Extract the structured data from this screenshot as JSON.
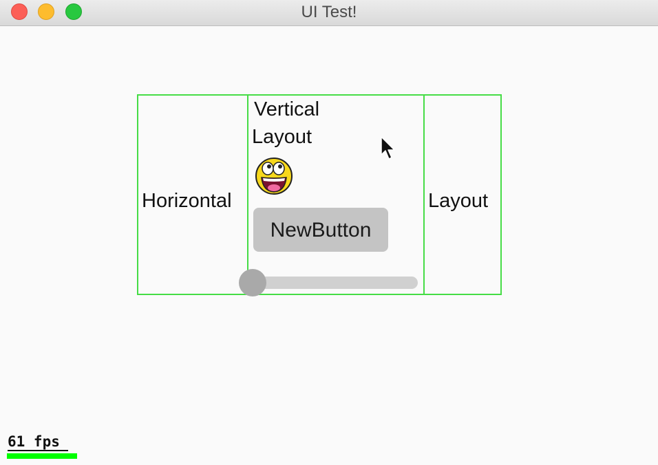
{
  "window": {
    "title": "UI Test!"
  },
  "layout": {
    "left_label": "Horizontal",
    "right_label": "Layout",
    "vertical_line1": "Vertical",
    "vertical_line2": "Layout",
    "border_color": "#45dc45"
  },
  "image": {
    "icon": "awesome-smiley-face-icon"
  },
  "button": {
    "label": "NewButton"
  },
  "slider": {
    "value": 0.0
  },
  "stats": {
    "fps_text": "61 fps",
    "fps_bar_fraction": 1.0,
    "fps_bar_color": "#00ff00"
  },
  "colors": {
    "close": "#fc5f57",
    "minimize": "#fdbc2e",
    "maximize": "#28c840"
  }
}
